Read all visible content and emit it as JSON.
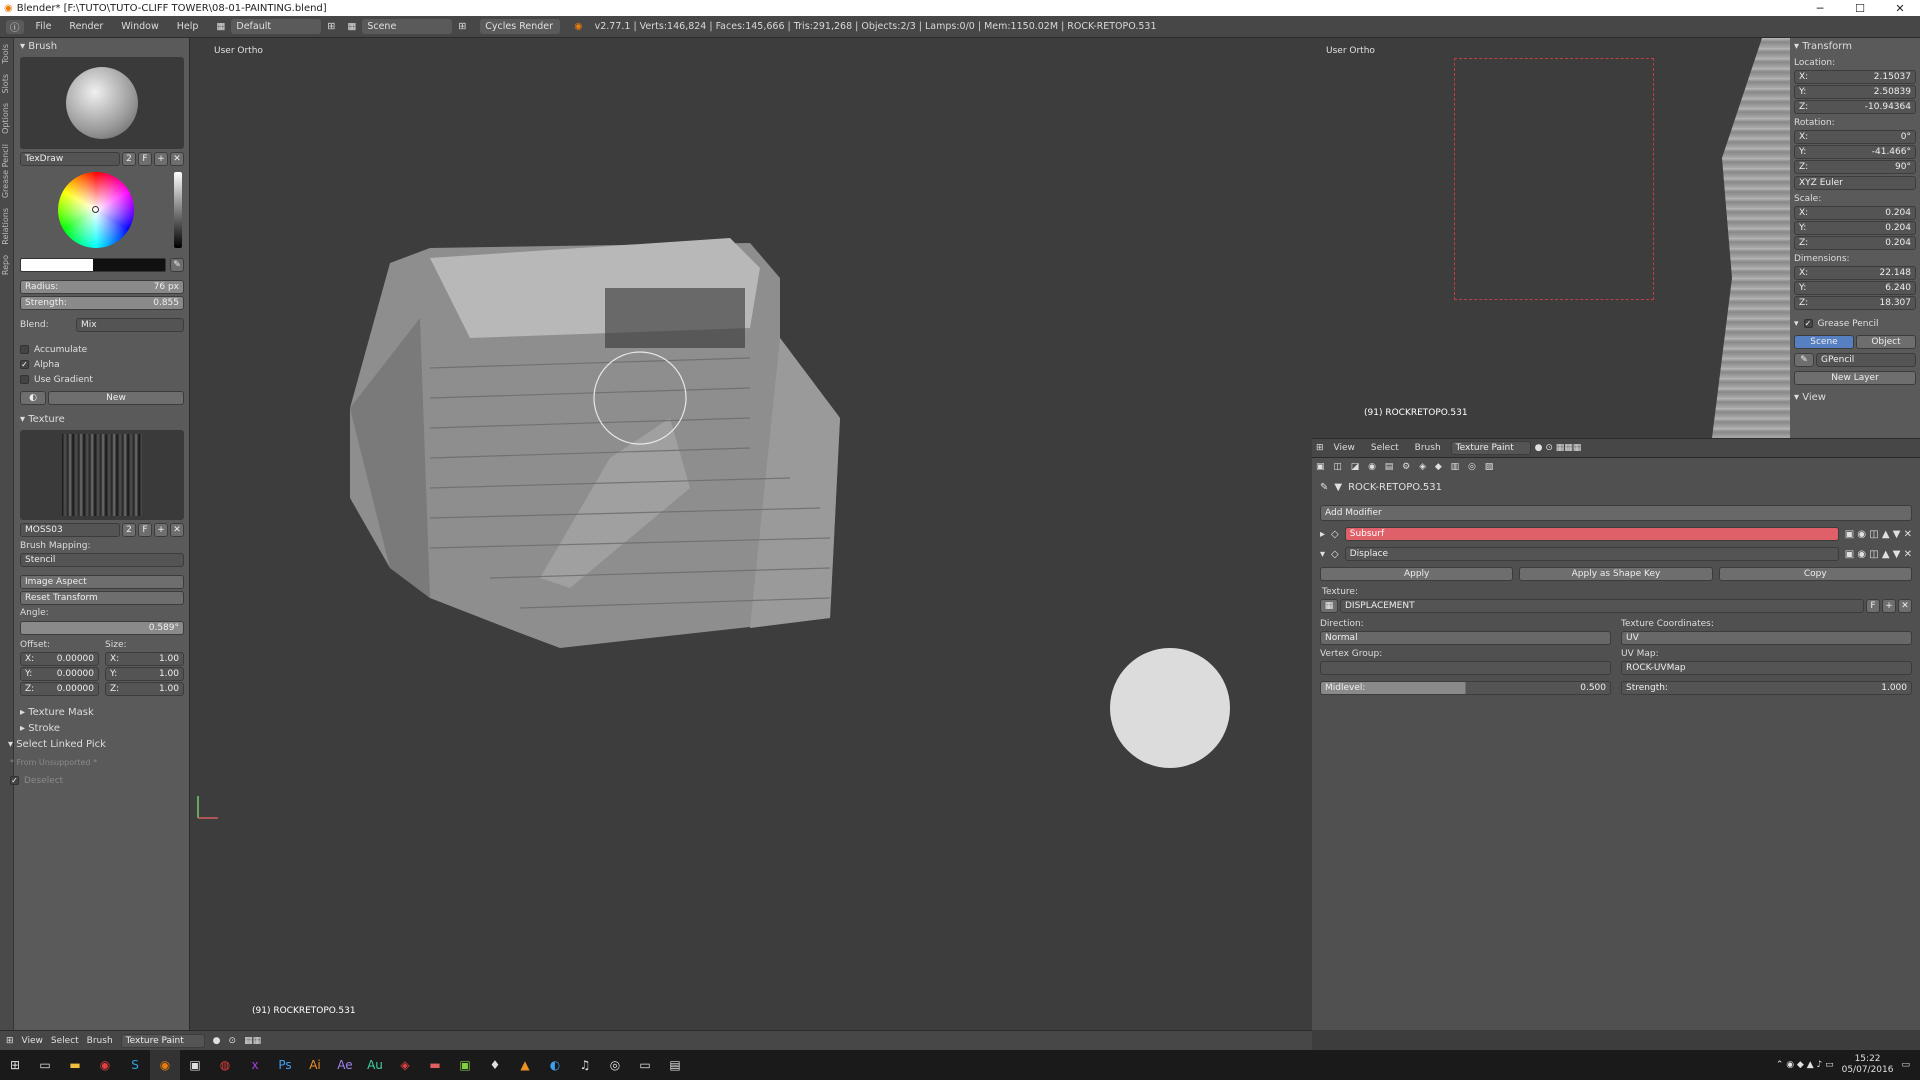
{
  "window": {
    "title": "Blender* [F:\\TUTO\\TUTO-CLIFF TOWER\\08-01-PAINTING.blend]",
    "minimize": "─",
    "maximize": "☐",
    "close": "✕"
  },
  "infobar": {
    "menus": [
      "File",
      "Render",
      "Window",
      "Help"
    ],
    "layout": "Default",
    "scene": "Scene",
    "engine": "Cycles Render",
    "stats": "v2.77.1 | Verts:146,824 | Faces:145,666 | Tris:291,268 | Objects:2/3 | Lamps:0/0 | Mem:1150.02M | ROCK-RETOPO.531"
  },
  "left_tabs": [
    "Tools",
    "Slots",
    "Options",
    "Grease Pencil",
    "Relations",
    "Repo"
  ],
  "brush": {
    "header": "Brush",
    "name": "TexDraw",
    "users": "2",
    "fake": "F",
    "radius_label": "Radius:",
    "radius_value": "76 px",
    "strength_label": "Strength:",
    "strength_value": "0.855",
    "blend_label": "Blend:",
    "blend_value": "Mix",
    "accumulate": "Accumulate",
    "alpha": "Alpha",
    "use_gradient": "Use Gradient",
    "new_button": "New"
  },
  "texture": {
    "header": "Texture",
    "name": "MOSS03",
    "users": "2",
    "fake": "F",
    "mapping_label": "Brush Mapping:",
    "mapping_value": "Stencil",
    "image_aspect": "Image Aspect",
    "reset_transform": "Reset Transform",
    "angle_label": "Angle:",
    "angle_value": "0.589°",
    "offset_label": "Offset:",
    "size_label": "Size:",
    "offset": [
      {
        "axis": "X:",
        "v": "0.00000"
      },
      {
        "axis": "Y:",
        "v": "0.00000"
      },
      {
        "axis": "Z:",
        "v": "0.00000"
      }
    ],
    "size": [
      {
        "axis": "X:",
        "v": "1.00"
      },
      {
        "axis": "Y:",
        "v": "1.00"
      },
      {
        "axis": "Z:",
        "v": "1.00"
      }
    ],
    "texture_mask": "Texture Mask",
    "stroke": "Stroke",
    "select_linked_pick": "Select Linked Pick",
    "from_unsupported": "* From Unsupported *",
    "deselect": "Deselect"
  },
  "viewport": {
    "label": "User Ortho",
    "object_label": "(91) ROCKRETOPO.531"
  },
  "bottom_header": {
    "menus": [
      "View",
      "Select",
      "Brush"
    ],
    "mode": "Texture Paint"
  },
  "right_view": {
    "label": "User Ortho",
    "object_label": "(91) ROCKRETOPO.531"
  },
  "transform": {
    "header": "Transform",
    "location_label": "Location:",
    "location": [
      {
        "axis": "X:",
        "v": "2.15037"
      },
      {
        "axis": "Y:",
        "v": "2.50839"
      },
      {
        "axis": "Z:",
        "v": "-10.94364"
      }
    ],
    "rotation_label": "Rotation:",
    "rotation": [
      {
        "axis": "X:",
        "v": "0°"
      },
      {
        "axis": "Y:",
        "v": "-41.466°"
      },
      {
        "axis": "Z:",
        "v": "90°"
      }
    ],
    "rotation_mode": "XYZ Euler",
    "scale_label": "Scale:",
    "scale": [
      {
        "axis": "X:",
        "v": "0.204"
      },
      {
        "axis": "Y:",
        "v": "0.204"
      },
      {
        "axis": "Z:",
        "v": "0.204"
      }
    ],
    "dimensions_label": "Dimensions:",
    "dimensions": [
      {
        "axis": "X:",
        "v": "22.148"
      },
      {
        "axis": "Y:",
        "v": "6.240"
      },
      {
        "axis": "Z:",
        "v": "18.307"
      }
    ],
    "grease_pencil": "Grease Pencil",
    "scene_tab": "Scene",
    "object_tab": "Object",
    "gpencil": "GPencil",
    "new_layer": "New Layer",
    "view": "View"
  },
  "props_header": {
    "menus": [
      "View",
      "Select",
      "Brush"
    ],
    "mode": "Texture Paint"
  },
  "modifiers": {
    "object_name": "ROCK-RETOPO.531",
    "add_modifier": "Add Modifier",
    "subsurf": "Subsurf",
    "displace": "Displace",
    "apply": "Apply",
    "apply_shape": "Apply as Shape Key",
    "copy": "Copy",
    "texture_label": "Texture:",
    "texture_value": "DISPLACEMENT",
    "direction_label": "Direction:",
    "direction_value": "Normal",
    "coords_label": "Texture Coordinates:",
    "coords_value": "UV",
    "vgroup_label": "Vertex Group:",
    "uvmap_label": "UV Map:",
    "uvmap_value": "ROCK-UVMap",
    "midlevel_label": "Midlevel:",
    "midlevel_value": "0.500",
    "strength_label": "Strength:",
    "strength_value": "1.000"
  },
  "taskbar": {
    "time": "15:22",
    "date": "05/07/2016"
  },
  "colors": {
    "accent_blue": "#5680c2",
    "subsurf_red": "#e0606a",
    "panel": "#5a5a5a",
    "viewport": "#3d3d3d"
  }
}
